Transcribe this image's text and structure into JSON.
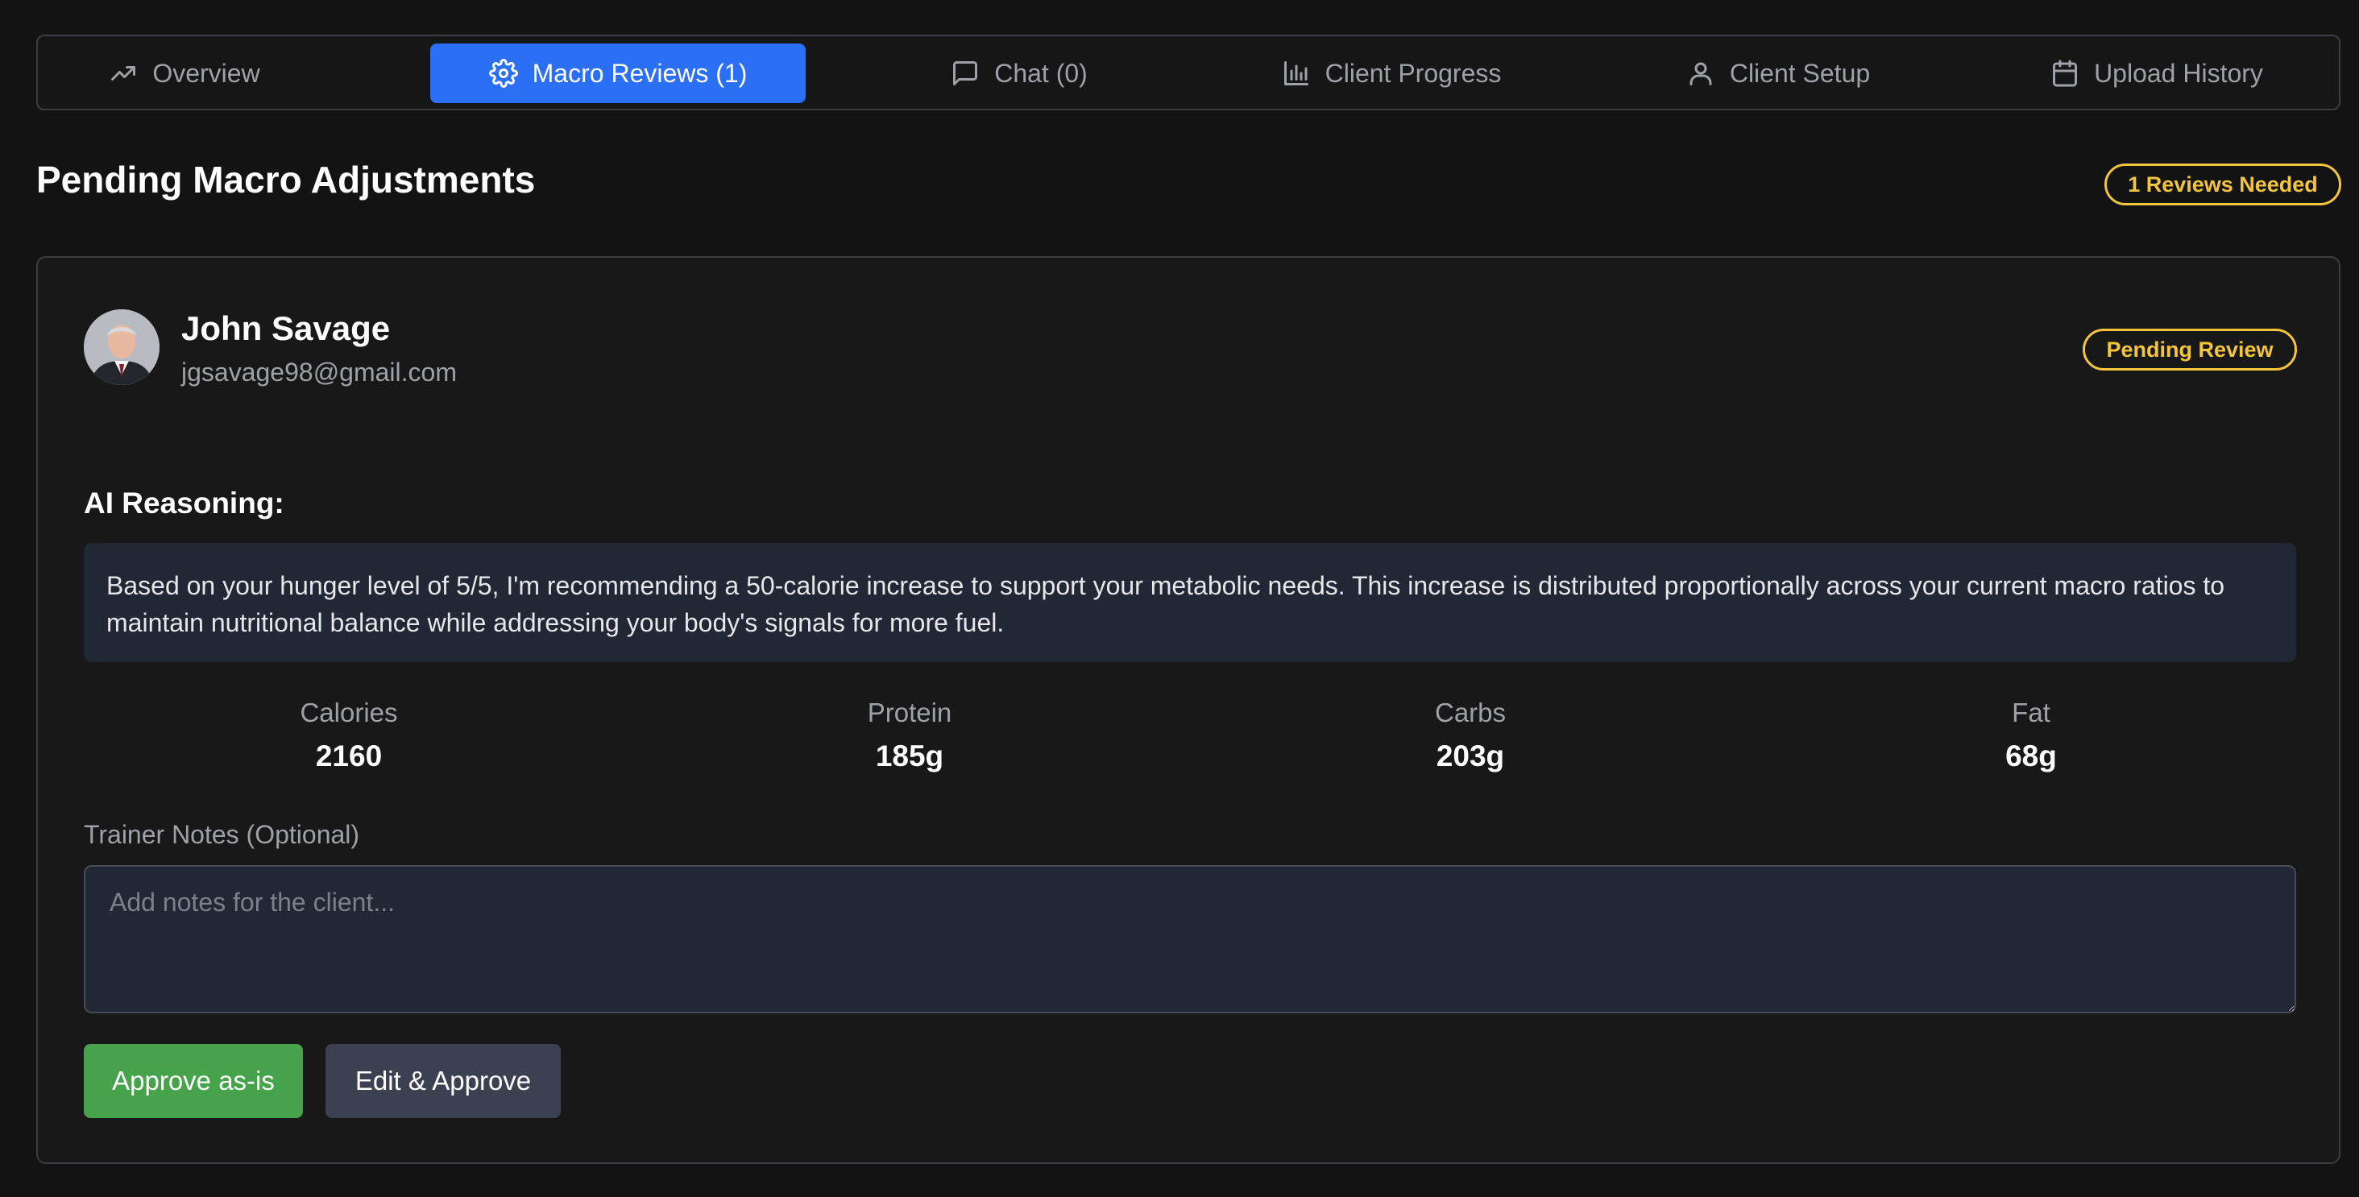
{
  "tabs": [
    {
      "label": "Overview",
      "icon": "trending-up-icon"
    },
    {
      "label": "Macro Reviews (1)",
      "icon": "gear-icon",
      "active": true
    },
    {
      "label": "Chat (0)",
      "icon": "chat-icon"
    },
    {
      "label": "Client Progress",
      "icon": "bar-chart-icon"
    },
    {
      "label": "Client Setup",
      "icon": "user-icon"
    },
    {
      "label": "Upload History",
      "icon": "calendar-icon"
    }
  ],
  "header": {
    "title": "Pending Macro Adjustments",
    "reviews_badge": "1 Reviews Needed"
  },
  "review": {
    "client_name": "John Savage",
    "client_email": "jgsavage98@gmail.com",
    "status_badge": "Pending Review",
    "reasoning_label": "AI Reasoning:",
    "reasoning_text": "Based on your hunger level of 5/5, I'm recommending a 50-calorie increase to support your metabolic needs. This increase is distributed proportionally across your current macro ratios to maintain nutritional balance while addressing your body's signals for more fuel.",
    "macros": [
      {
        "label": "Calories",
        "value": "2160"
      },
      {
        "label": "Protein",
        "value": "185g"
      },
      {
        "label": "Carbs",
        "value": "203g"
      },
      {
        "label": "Fat",
        "value": "68g"
      }
    ],
    "notes_label": "Trainer Notes (Optional)",
    "notes_placeholder": "Add notes for the client...",
    "notes_value": "",
    "approve_label": "Approve as-is",
    "edit_label": "Edit & Approve"
  },
  "colors": {
    "accent": "#2a6ff6",
    "warning": "#f2c53d",
    "success": "#46a24b"
  }
}
